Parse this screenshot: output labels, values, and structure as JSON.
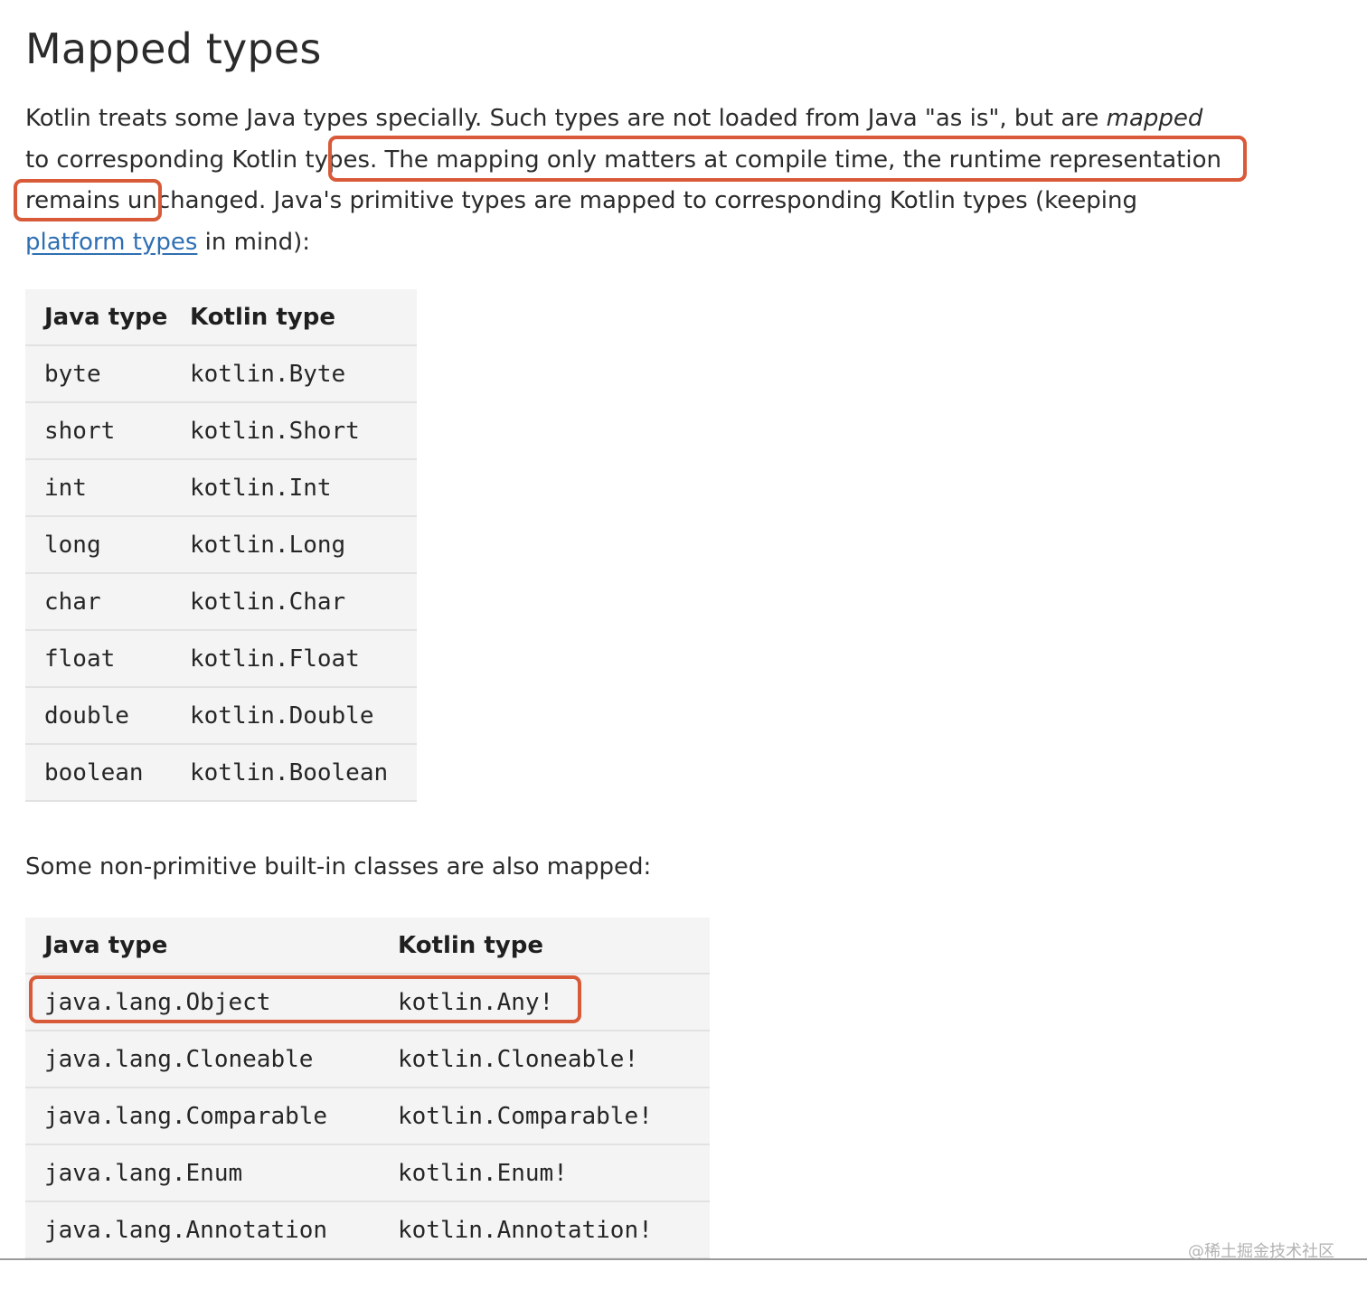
{
  "title": "Mapped types",
  "intro": {
    "part1": "Kotlin treats some Java types specially. Such types are not loaded from Java \"as is\", but are ",
    "mapped_word": "mapped",
    "part2": " to corresponding Kotlin types. The mapping only matters at compile time, the runtime representation remains unchanged. Java's primitive types are mapped to corresponding Kotlin types (keeping ",
    "link_text": "platform types",
    "part3": " in mind):"
  },
  "primitive_table": {
    "headers": [
      "Java type",
      "Kotlin type"
    ],
    "rows": [
      [
        "byte",
        "kotlin.Byte"
      ],
      [
        "short",
        "kotlin.Short"
      ],
      [
        "int",
        "kotlin.Int"
      ],
      [
        "long",
        "kotlin.Long"
      ],
      [
        "char",
        "kotlin.Char"
      ],
      [
        "float",
        "kotlin.Float"
      ],
      [
        "double",
        "kotlin.Double"
      ],
      [
        "boolean",
        "kotlin.Boolean"
      ]
    ]
  },
  "non_primitive_intro": "Some non-primitive built-in classes are also mapped:",
  "class_table": {
    "headers": [
      "Java type",
      "Kotlin type"
    ],
    "rows": [
      [
        "java.lang.Object",
        "kotlin.Any!"
      ],
      [
        "java.lang.Cloneable",
        "kotlin.Cloneable!"
      ],
      [
        "java.lang.Comparable",
        "kotlin.Comparable!"
      ],
      [
        "java.lang.Enum",
        "kotlin.Enum!"
      ],
      [
        "java.lang.Annotation",
        "kotlin.Annotation!"
      ]
    ]
  },
  "watermark": "@稀土掘金技术社区",
  "colors": {
    "highlight_box": "#d85a38",
    "link": "#2f6fb3",
    "table_bg": "#f4f4f4"
  }
}
